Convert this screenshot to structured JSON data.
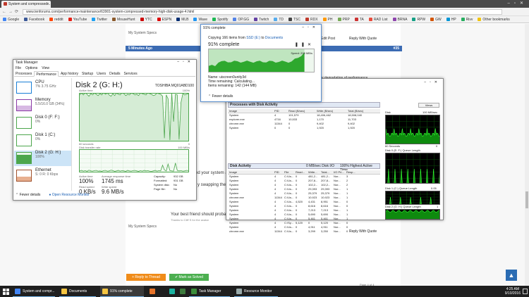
{
  "browser": {
    "tab_title": "System and compressed...",
    "url": "www.tenforums.com/performance-maintenance/63901-system-compressed-memory-high-disk-usage-4.html",
    "bookmarks": [
      {
        "label": "Google",
        "color": "#4285f4"
      },
      {
        "label": "Facebook",
        "color": "#3b5998"
      },
      {
        "label": "reddit",
        "color": "#ff4500"
      },
      {
        "label": "YouTube",
        "color": "#e62117"
      },
      {
        "label": "Twitter",
        "color": "#1da1f2"
      },
      {
        "label": "MouseHunt",
        "color": "#8b5a2b"
      },
      {
        "label": "YTC",
        "color": "#cc0000"
      },
      {
        "label": "ESPN",
        "color": "#d00"
      },
      {
        "label": "MLB",
        "color": "#002d72"
      },
      {
        "label": "Wave",
        "color": "#2196f3"
      },
      {
        "label": "Spotify",
        "color": "#1db954"
      },
      {
        "label": "OP.GG",
        "color": "#5383e8"
      },
      {
        "label": "Twitch",
        "color": "#6441a5"
      },
      {
        "label": "TD",
        "color": "#55acee"
      },
      {
        "label": "TSC",
        "color": "#444"
      },
      {
        "label": "RDX",
        "color": "#c0392b"
      },
      {
        "label": "PH",
        "color": "#f90"
      },
      {
        "label": "PRP",
        "color": "#7a5"
      },
      {
        "label": "TA",
        "color": "#c33"
      },
      {
        "label": "RAD List",
        "color": "#e74c3c"
      },
      {
        "label": "BRNA",
        "color": "#8e44ad"
      },
      {
        "label": "RPW",
        "color": "#16a085"
      },
      {
        "label": "GW",
        "color": "#d35400"
      },
      {
        "label": "HP",
        "color": "#0096d6"
      },
      {
        "label": "Rivv",
        "color": "#27ae60"
      },
      {
        "label": "Other bookmarks",
        "color": "#f1c40f"
      }
    ]
  },
  "forum": {
    "my_specs": "My System Specs",
    "minutes_ago": "5 Minutes Ago",
    "post_number": "#35",
    "edit_post": "Edit Post",
    "reply_with_quote": "Reply With Quote",
    "degradation_text": "y degradation of performance",
    "text_line1": "nd your system and",
    "text_line2": "y swapping then you",
    "best_friend": "Your best friend should probab",
    "sig_small": "Thanks to Cliff S for the avatar",
    "reply_to_thread": "+ Reply to Thread",
    "mark_solved": "✔ Mark as Solved",
    "pagination": "Page 4 of 4"
  },
  "task_manager": {
    "title": "Task Manager",
    "menu": [
      "File",
      "Options",
      "View"
    ],
    "tabs": [
      "Processes",
      "Performance",
      "App history",
      "Startup",
      "Users",
      "Details",
      "Services"
    ],
    "resources": [
      {
        "name": "CPU",
        "sub": "7% 3.75 GHz",
        "color": "#1a7fd6"
      },
      {
        "name": "Memory",
        "sub": "5.5/16.0 GB (34%)",
        "color": "#8b3aa6"
      },
      {
        "name": "Disk 0 (F: F:)",
        "sub": "0%",
        "color": "#4ca64c"
      },
      {
        "name": "Disk 1 (C:)",
        "sub": "0%",
        "color": "#4ca64c"
      },
      {
        "name": "Disk 2 (G: H:)",
        "sub": "100%",
        "color": "#4ca64c"
      },
      {
        "name": "Ethernet",
        "sub": "S: 0 R: 0 Kbps",
        "color": "#a0522d"
      }
    ],
    "disk_title": "Disk 2 (G: H:)",
    "disk_model": "TOSHIBA MQ01ABD100",
    "active_time_label": "Active time",
    "pct_100": "100%",
    "seconds_60": "60 seconds",
    "zero": "0",
    "transfer_label": "Disk transfer rate",
    "mb_100": "100 MB/s",
    "active_label": "Active time",
    "active_val": "100%",
    "resp_label": "Average response time",
    "resp_val": "1745 ms",
    "read_label": "Read speed",
    "read_val": "0 KB/s",
    "write_label": "Write speed",
    "write_val": "9.6 MB/s",
    "cap_label": "Capacity:",
    "cap_val": "932 GB",
    "fmt_label": "Formatted:",
    "fmt_val": "931 GB",
    "sys_label": "System disk:",
    "sys_val": "No",
    "page_label": "Page file:",
    "page_val": "No",
    "fewer": "Fewer details",
    "open_rm": "Open Resource Monitor",
    "disk_active_series": [
      72,
      75,
      72,
      76,
      73,
      70,
      74,
      72,
      75,
      73,
      71,
      74,
      72,
      76,
      73,
      75,
      72,
      70,
      74,
      71,
      75,
      73,
      72,
      76,
      74,
      71,
      73,
      72,
      75,
      74,
      72,
      73,
      71,
      75,
      74,
      73,
      72,
      76,
      74,
      73,
      71,
      72,
      75,
      74,
      73,
      70,
      4,
      72,
      66,
      1,
      75,
      30,
      73,
      72,
      2,
      60,
      74,
      72,
      73,
      74
    ],
    "disk_transfer_series": [
      4,
      6,
      3,
      5,
      2,
      7,
      4,
      3,
      5,
      6,
      3,
      4,
      2,
      5,
      6,
      3,
      4,
      7,
      5,
      2,
      4,
      6,
      3,
      5,
      4,
      2,
      6,
      4,
      3,
      5,
      6,
      4,
      2,
      5,
      3,
      6,
      4,
      5,
      3,
      2,
      4,
      6,
      3,
      5,
      4,
      30,
      8,
      4,
      35,
      5,
      4,
      3,
      40,
      6,
      4,
      5,
      3,
      4,
      6,
      5
    ]
  },
  "copy_dialog": {
    "title": "91% complete",
    "sub_prefix": "Copying 166 items from",
    "sub_from": "SSD (E:)",
    "sub_to_word": "to",
    "sub_to": "Documents",
    "pct_label": "91% complete",
    "speed": "Speed: 208 MB/s",
    "name_label": "Name:",
    "name_val": "uiscreen0unity3d",
    "time_label": "Time remaining:",
    "time_val": "Calculating...",
    "items_label": "Items remaining:",
    "items_val": "142 (144 MB)",
    "fewer": "Fewer details",
    "progress": 0.91
  },
  "resource_monitor": {
    "processes_header": "Processes with Disk Activity",
    "proc_cols": [
      "Image",
      "PID",
      "Read (B/sec)",
      "Write (B/sec)",
      "Total (B/sec)"
    ],
    "proc_rows": [
      [
        "System",
        "4",
        "101,579",
        "18,406,462",
        "18,508,040"
      ],
      [
        "explorer.exe",
        "4716",
        "10,533",
        "1,170",
        "11,703"
      ],
      [
        "chrome.exe",
        "11344",
        "0",
        "9,402",
        "9,402"
      ],
      [
        "System",
        "0",
        "0",
        "1,920",
        "1,920"
      ]
    ],
    "disk_header": "Disk Activity",
    "disk_io": "0 MB/sec Disk I/O",
    "highest": "100% Highest Active Time",
    "disk_cols": [
      "Image",
      "PID",
      "File",
      "Read...",
      "Write...",
      "Total...",
      "I/O Pri...",
      "Resp..."
    ],
    "disk_rows": [
      [
        "System",
        "4",
        "C:\\Us...",
        "0",
        "481,2...",
        "481,2...",
        "Nor...",
        "3"
      ],
      [
        "System",
        "4",
        "C:\\Us...",
        "0",
        "207,8...",
        "207,8...",
        "Nor...",
        "2"
      ],
      [
        "System",
        "4",
        "C:\\Us...",
        "0",
        "102,2...",
        "102,2...",
        "Nor...",
        "2"
      ],
      [
        "System",
        "4",
        "C:\\Us...",
        "0",
        "29,393",
        "29,393",
        "Nor...",
        "1"
      ],
      [
        "System",
        "4",
        "C:\\Us...",
        "0",
        "25,379",
        "25,379",
        "Nor...",
        "1"
      ],
      [
        "chrome.exe",
        "11344",
        "C:\\Us...",
        "0",
        "10,923",
        "10,923",
        "Nor...",
        "1"
      ],
      [
        "System",
        "4",
        "C:\\Us...",
        "4,520",
        "4,431",
        "8,951",
        "Nor...",
        "0"
      ],
      [
        "System",
        "4",
        "C:\\Us...",
        "0",
        "8,616",
        "8,616",
        "Nor...",
        "0"
      ],
      [
        "System",
        "4",
        "C:\\Us...",
        "0",
        "7,213",
        "7,213",
        "Nor...",
        "1"
      ],
      [
        "System",
        "4",
        "C:\\Us...",
        "0",
        "5,690",
        "5,690",
        "Nor...",
        "1"
      ],
      [
        "System",
        "4",
        "C:\\Us...",
        "0",
        "5,461",
        "5,461",
        "Nor...",
        "1"
      ],
      [
        "System",
        "4",
        "C:\\Sy...",
        "5,120",
        "0",
        "5,120",
        "Nor...",
        "0"
      ],
      [
        "System",
        "4",
        "C:\\Us...",
        "0",
        "4,911",
        "4,911",
        "Nor...",
        "0"
      ],
      [
        "chrome.exe",
        "11344",
        "C:\\Us...",
        "0",
        "3,299",
        "3,250",
        "Nor...",
        "0"
      ]
    ],
    "views": "Views",
    "graph_disk": "Disk",
    "graph_100": "100 MB/sec",
    "graph_60": "60 Seconds",
    "graph_0": "0",
    "graph_q0": "Disk 0 (E: F:) Queue Length",
    "graph_q1": "Disk 1 (C:) Queue Length",
    "graph_q1_val": "0.05",
    "graph_q2": "Disk 2 (G: H:) Queue Length",
    "q_1": "1"
  },
  "taskbar": {
    "items": [
      {
        "label": "System and compr...",
        "color": "#4285f4"
      },
      {
        "label": "Documents",
        "color": "#f4c542"
      },
      {
        "label": "91% complete",
        "color": "#f4c542"
      },
      {
        "label": "Task Manager",
        "color": "#3a8d3a"
      },
      {
        "label": "Resource Monitor",
        "color": "#9aa"
      }
    ],
    "time": "4:25 AM",
    "date": "9/10/2016"
  }
}
